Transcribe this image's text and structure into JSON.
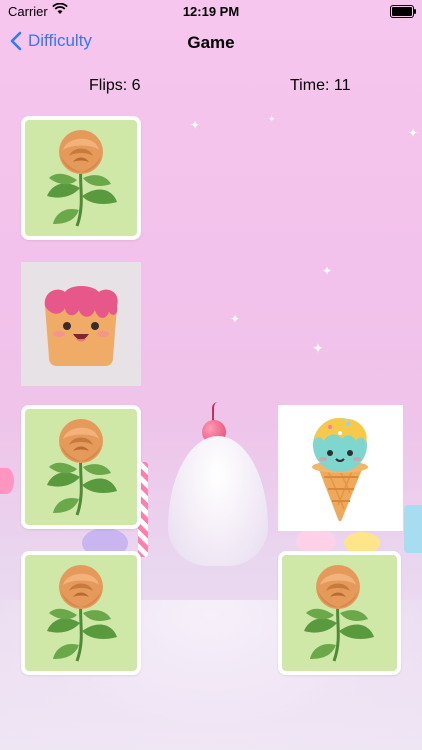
{
  "status_bar": {
    "carrier": "Carrier",
    "time": "12:19 PM"
  },
  "nav": {
    "back_label": "Difficulty",
    "title": "Game"
  },
  "stats": {
    "flips": "Flips: 6",
    "time": "Time: 11"
  },
  "cards": [
    {
      "state": "face-down",
      "image": "rose-card-back"
    },
    {
      "state": "face-up",
      "image": "toast-character"
    },
    {
      "state": "face-down",
      "image": "rose-card-back"
    },
    {
      "state": "face-up",
      "image": "ice-cream-cone-character"
    },
    {
      "state": "face-down",
      "image": "rose-card-back"
    },
    {
      "state": "face-down",
      "image": "rose-card-back"
    }
  ],
  "colors": {
    "accent": "#2f7bf3",
    "card_back_bg": "#cfe8a8",
    "rose": "#e59a5c",
    "leaf": "#5a9a3f"
  }
}
